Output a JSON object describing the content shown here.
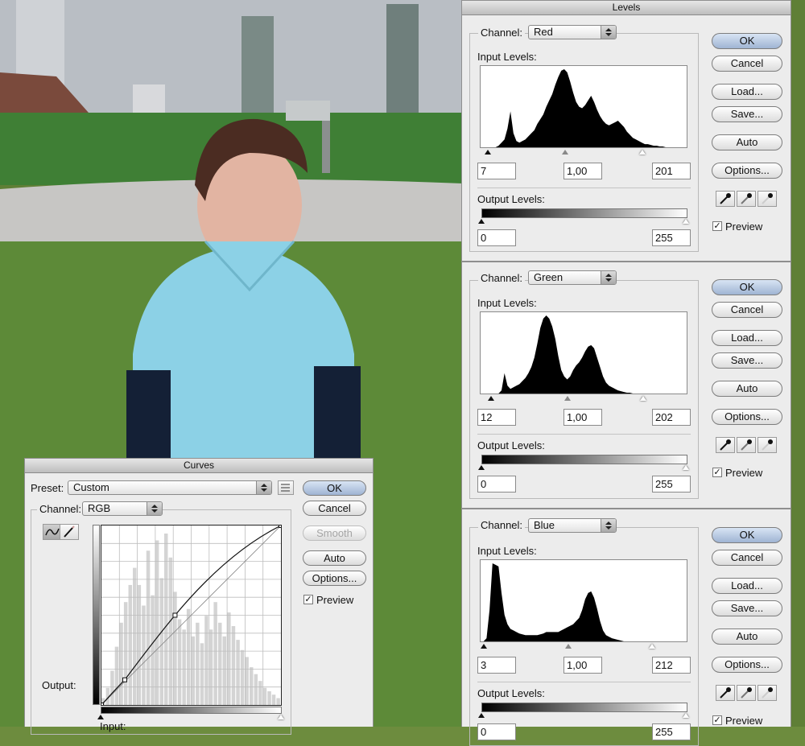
{
  "levels_title": "Levels",
  "curves_title": "Curves",
  "levels": [
    {
      "channel_label": "Channel:",
      "channel": "Red",
      "input_levels_label": "Input Levels:",
      "input_black": "7",
      "input_gamma": "1,00",
      "input_white": "201",
      "output_levels_label": "Output Levels:",
      "output_black": "0",
      "output_white": "255",
      "ok": "OK",
      "cancel": "Cancel",
      "load": "Load...",
      "save": "Save...",
      "auto": "Auto",
      "options": "Options...",
      "preview": "Preview",
      "histogram": [
        0,
        0,
        0,
        0,
        0,
        0,
        2,
        6,
        10,
        24,
        46,
        18,
        8,
        6,
        8,
        10,
        14,
        18,
        22,
        30,
        36,
        42,
        52,
        60,
        68,
        80,
        90,
        98,
        100,
        96,
        84,
        70,
        58,
        52,
        50,
        54,
        60,
        66,
        58,
        48,
        40,
        34,
        30,
        28,
        30,
        32,
        34,
        30,
        26,
        20,
        16,
        12,
        10,
        8,
        6,
        4,
        4,
        3,
        2,
        2,
        1,
        1,
        0,
        0,
        0,
        0,
        0,
        0,
        0,
        0
      ]
    },
    {
      "channel_label": "Channel:",
      "channel": "Green",
      "input_levels_label": "Input Levels:",
      "input_black": "12",
      "input_gamma": "1,00",
      "input_white": "202",
      "output_levels_label": "Output Levels:",
      "output_black": "0",
      "output_white": "255",
      "ok": "OK",
      "cancel": "Cancel",
      "load": "Load...",
      "save": "Save...",
      "auto": "Auto",
      "options": "Options...",
      "preview": "Preview",
      "histogram": [
        0,
        0,
        0,
        0,
        0,
        0,
        0,
        4,
        26,
        10,
        6,
        8,
        10,
        12,
        16,
        20,
        26,
        34,
        46,
        64,
        84,
        96,
        100,
        96,
        86,
        70,
        48,
        30,
        22,
        18,
        22,
        30,
        36,
        40,
        46,
        54,
        60,
        62,
        58,
        46,
        34,
        22,
        14,
        10,
        8,
        6,
        4,
        3,
        2,
        1,
        1,
        0,
        0,
        0,
        0,
        0,
        0,
        0,
        0,
        0,
        0,
        0,
        0,
        0,
        0,
        0,
        0,
        0,
        0,
        0
      ]
    },
    {
      "channel_label": "Channel:",
      "channel": "Blue",
      "input_levels_label": "Input Levels:",
      "input_black": "3",
      "input_gamma": "1,00",
      "input_white": "212",
      "output_levels_label": "Output Levels:",
      "output_black": "0",
      "output_white": "255",
      "ok": "OK",
      "cancel": "Cancel",
      "load": "Load...",
      "save": "Save...",
      "auto": "Auto",
      "options": "Options...",
      "preview": "Preview",
      "histogram": [
        0,
        0,
        4,
        40,
        100,
        98,
        96,
        62,
        34,
        22,
        16,
        14,
        12,
        10,
        9,
        8,
        8,
        8,
        8,
        8,
        9,
        10,
        12,
        12,
        12,
        12,
        12,
        14,
        16,
        18,
        20,
        22,
        26,
        30,
        40,
        54,
        62,
        64,
        56,
        42,
        26,
        14,
        8,
        6,
        4,
        3,
        2,
        1,
        0,
        0,
        0,
        0,
        0,
        0,
        0,
        0,
        0,
        0,
        0,
        0,
        0,
        0,
        0,
        0,
        0,
        0,
        0,
        0,
        0,
        0
      ]
    }
  ],
  "curves": {
    "preset_label": "Preset:",
    "preset": "Custom",
    "channel_label": "Channel:",
    "channel": "RGB",
    "ok": "OK",
    "cancel": "Cancel",
    "smooth": "Smooth",
    "auto": "Auto",
    "options": "Options...",
    "preview": "Preview",
    "output_label": "Output:",
    "input_label": "Input:",
    "histogram": [
      4,
      10,
      20,
      34,
      48,
      60,
      70,
      80,
      70,
      58,
      90,
      64,
      96,
      74,
      100,
      86,
      66,
      50,
      44,
      56,
      40,
      48,
      36,
      52,
      44,
      60,
      48,
      40,
      54,
      46,
      38,
      32,
      28,
      22,
      18,
      14,
      10,
      8,
      6,
      4
    ]
  }
}
